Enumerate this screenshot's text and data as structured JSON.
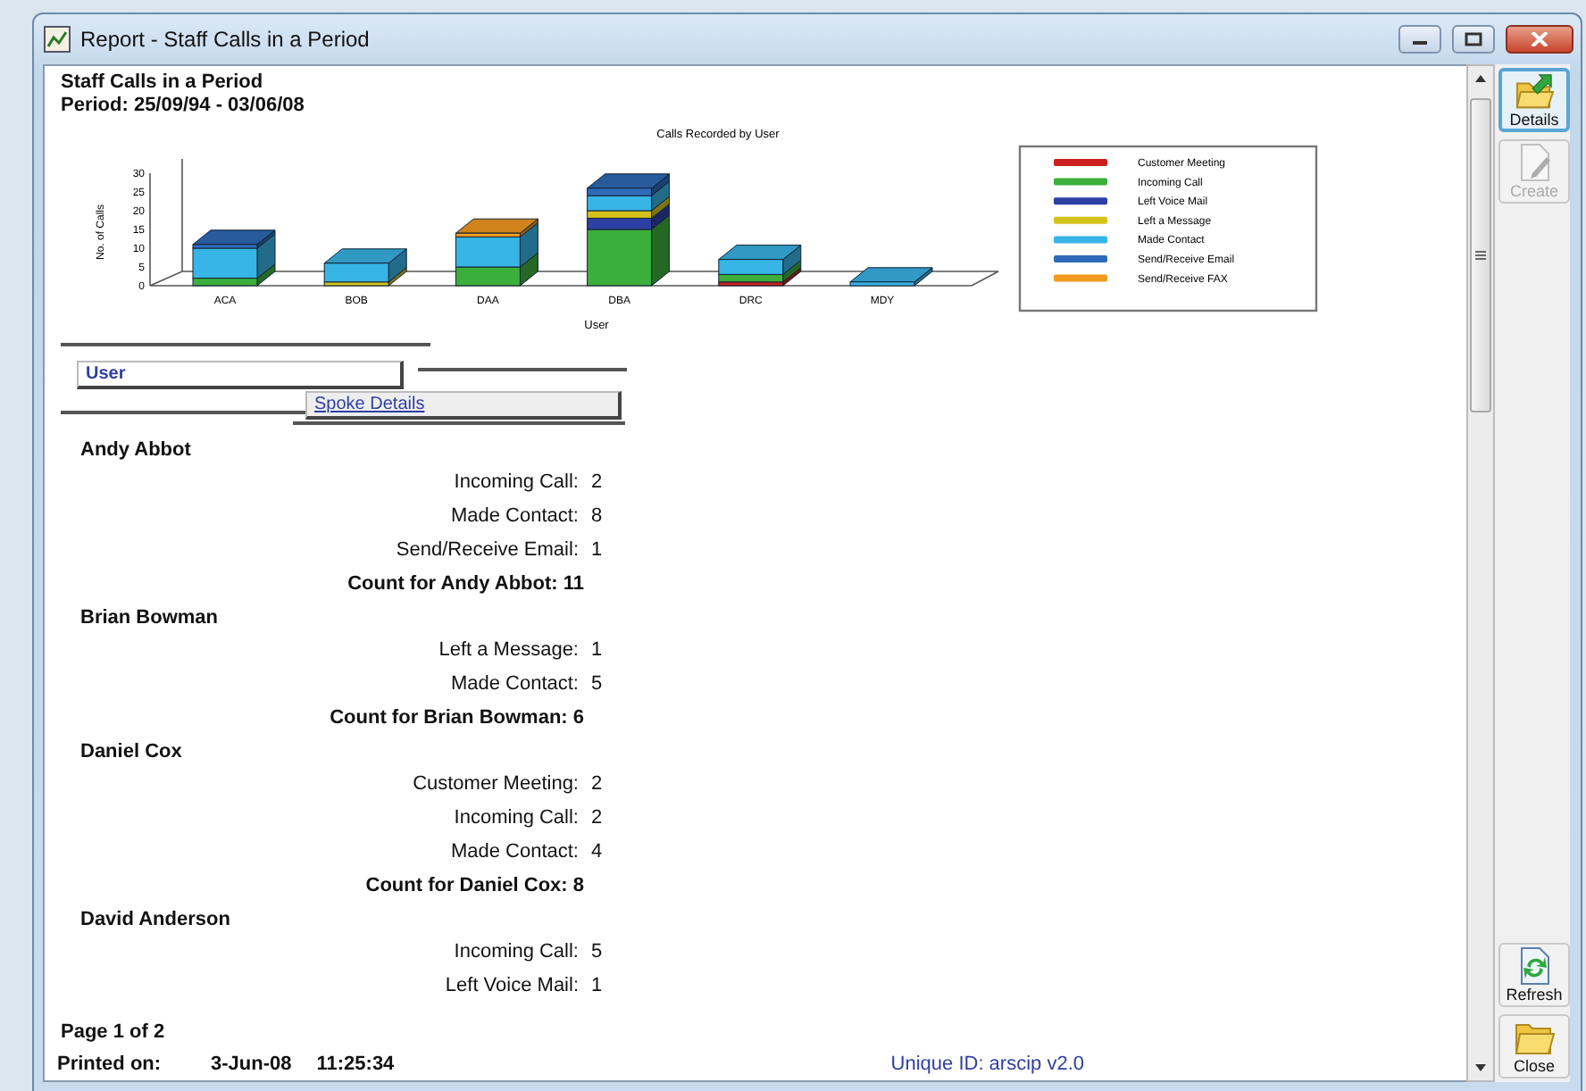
{
  "window": {
    "title": "Report - Staff Calls in a Period"
  },
  "report": {
    "title": "Staff Calls in a Period",
    "period": "Period: 25/09/94 - 03/06/08",
    "chart_data": {
      "type": "bar",
      "stacked": true,
      "title": "Calls Recorded by User",
      "xlabel": "User",
      "ylabel": "No. of Calls",
      "categories": [
        "ACA",
        "BOB",
        "DAA",
        "DBA",
        "DRC",
        "MDY"
      ],
      "ylim": [
        0,
        30
      ],
      "yticks": [
        0,
        5,
        10,
        15,
        20,
        25,
        30
      ],
      "series": [
        {
          "name": "Customer Meeting",
          "color": "#cc2020",
          "values": [
            0,
            0,
            0,
            0,
            1,
            0
          ]
        },
        {
          "name": "Incoming Call",
          "color": "#3cae3c",
          "values": [
            2,
            0,
            5,
            15,
            2,
            0
          ]
        },
        {
          "name": "Left Voice Mail",
          "color": "#2e3fa3",
          "values": [
            0,
            0,
            0,
            3,
            0,
            0
          ]
        },
        {
          "name": "Left a Message",
          "color": "#d4c21a",
          "values": [
            0,
            1,
            0,
            2,
            0,
            0
          ]
        },
        {
          "name": "Made Contact",
          "color": "#38b4e6",
          "values": [
            8,
            5,
            8,
            4,
            4,
            1
          ]
        },
        {
          "name": "Send/Receive Email",
          "color": "#2e6bb8",
          "values": [
            1,
            0,
            0,
            2,
            0,
            0
          ]
        },
        {
          "name": "Send/Receive FAX",
          "color": "#f39a1e",
          "values": [
            0,
            0,
            1,
            0,
            0,
            0
          ]
        }
      ]
    },
    "group_headers": [
      {
        "label": "User"
      },
      {
        "label": "Spoke Details"
      }
    ],
    "groups": [
      {
        "name": "Andy Abbot",
        "details": [
          {
            "label": "Incoming Call:",
            "value": "2"
          },
          {
            "label": "Made Contact:",
            "value": "8"
          },
          {
            "label": "Send/Receive Email:",
            "value": "1"
          }
        ],
        "count": "Count for Andy Abbot: 11"
      },
      {
        "name": "Brian Bowman",
        "details": [
          {
            "label": "Left a Message:",
            "value": "1"
          },
          {
            "label": "Made Contact:",
            "value": "5"
          }
        ],
        "count": "Count for Brian Bowman: 6"
      },
      {
        "name": "Daniel Cox",
        "details": [
          {
            "label": "Customer Meeting:",
            "value": "2"
          },
          {
            "label": "Incoming Call:",
            "value": "2"
          },
          {
            "label": "Made Contact:",
            "value": "4"
          }
        ],
        "count": "Count for Daniel Cox: 8"
      },
      {
        "name": "David Anderson",
        "details": [
          {
            "label": "Incoming Call:",
            "value": "5"
          },
          {
            "label": "Left Voice Mail:",
            "value": "1"
          }
        ]
      }
    ],
    "footer": {
      "page": "Page 1 of 2",
      "printed_label": "Printed on:",
      "printed_date": "3-Jun-08",
      "printed_time": "11:25:34",
      "unique_id": "Unique ID: arscip v2.0"
    }
  },
  "toolbar": {
    "buttons": [
      {
        "label": "Details",
        "kind": "details",
        "focused": true,
        "disabled": false
      },
      {
        "label": "Create",
        "kind": "create",
        "focused": false,
        "disabled": true
      },
      {
        "label": "Refresh",
        "kind": "refresh",
        "focused": false,
        "disabled": false
      },
      {
        "label": "Close",
        "kind": "close",
        "focused": false,
        "disabled": false
      }
    ]
  }
}
